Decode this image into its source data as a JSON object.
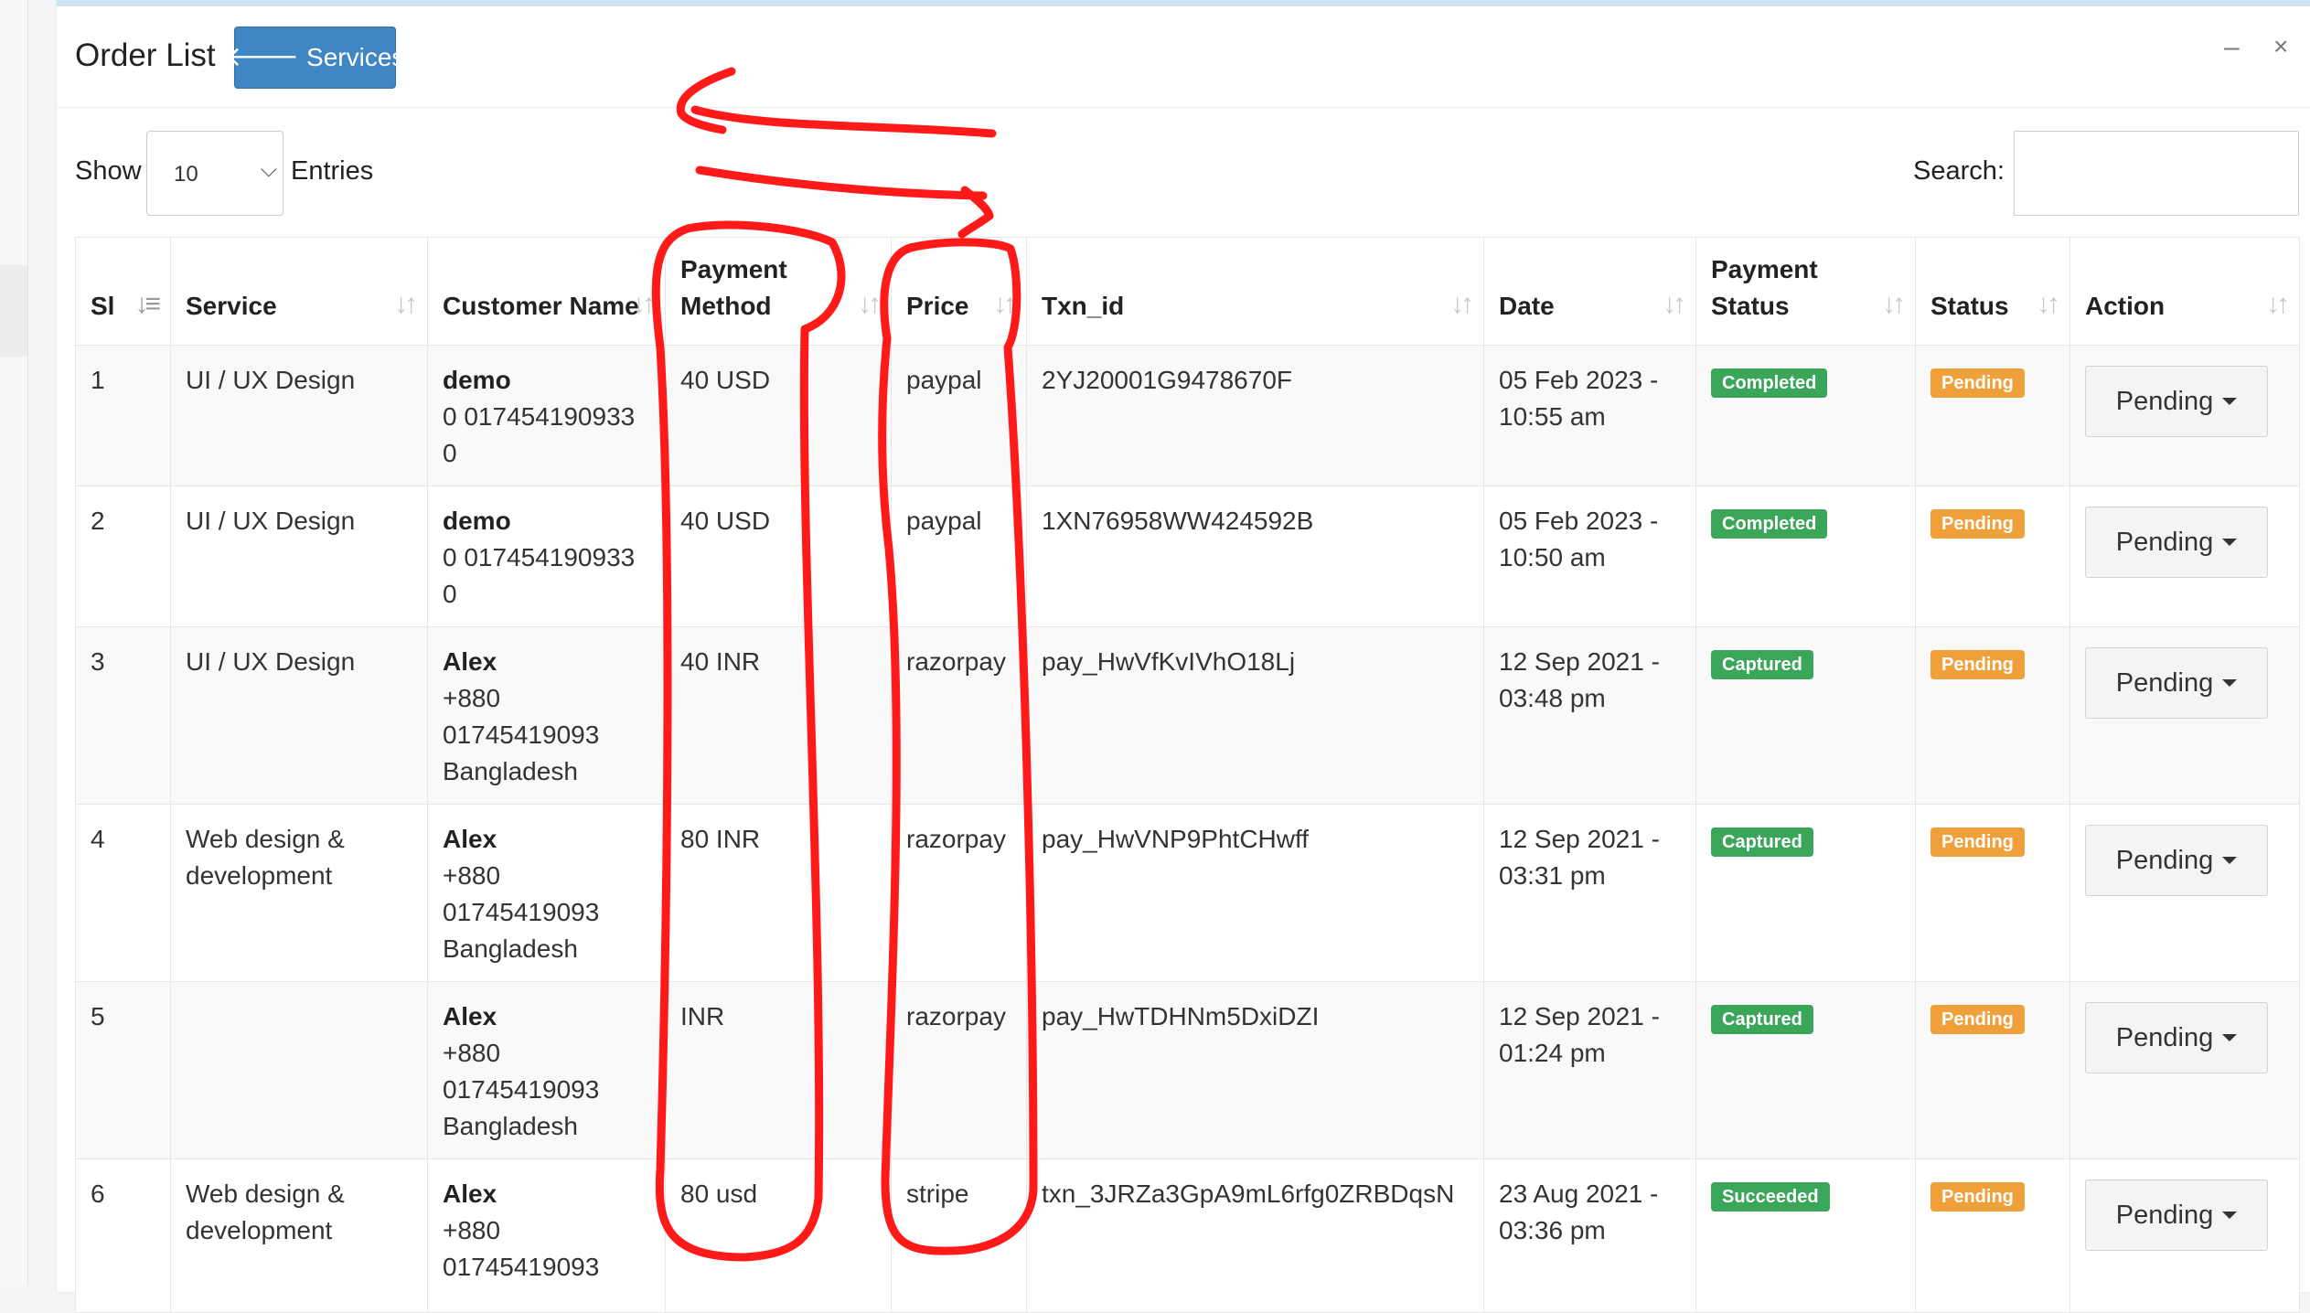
{
  "window": {
    "minimize_glyph": "–",
    "close_glyph": "×"
  },
  "header": {
    "title": "Order List",
    "services_button": {
      "icon": "arrow-left-icon",
      "label": "Services"
    }
  },
  "controls": {
    "show_label": "Show",
    "entries_value": "10",
    "entries_label": "Entries",
    "search_label": "Search:",
    "search_value": ""
  },
  "table": {
    "columns": [
      {
        "key": "sl",
        "label": "Sl"
      },
      {
        "key": "service",
        "label": "Service"
      },
      {
        "key": "customer",
        "label": "Customer Name"
      },
      {
        "key": "payment_method",
        "label": "Payment Method"
      },
      {
        "key": "price",
        "label": "Price"
      },
      {
        "key": "txn_id",
        "label": "Txn_id"
      },
      {
        "key": "date",
        "label": "Date"
      },
      {
        "key": "payment_status",
        "label": "Payment Status"
      },
      {
        "key": "status",
        "label": "Status"
      },
      {
        "key": "action",
        "label": "Action"
      }
    ],
    "rows": [
      {
        "sl": "1",
        "service": "UI / UX Design",
        "customer_name": "demo",
        "customer_phone": "0 017454190933",
        "customer_country": "0",
        "payment_method": "40 USD",
        "price": "paypal",
        "txn_id": "2YJ20001G9478670F",
        "date": "05 Feb 2023 -",
        "time": "10:55 am",
        "payment_status": "Completed",
        "status": "Pending",
        "action": "Pending"
      },
      {
        "sl": "2",
        "service": "UI / UX Design",
        "customer_name": "demo",
        "customer_phone": "0 017454190933",
        "customer_country": "0",
        "payment_method": "40 USD",
        "price": "paypal",
        "txn_id": "1XN76958WW424592B",
        "date": "05 Feb 2023 -",
        "time": "10:50 am",
        "payment_status": "Completed",
        "status": "Pending",
        "action": "Pending"
      },
      {
        "sl": "3",
        "service": "UI / UX Design",
        "customer_name": "Alex",
        "customer_phone": "+880 01745419093",
        "customer_country": "Bangladesh",
        "payment_method": "40 INR",
        "price": "razorpay",
        "txn_id": "pay_HwVfKvIVhO18Lj",
        "date": "12 Sep 2021 -",
        "time": "03:48 pm",
        "payment_status": "Captured",
        "status": "Pending",
        "action": "Pending"
      },
      {
        "sl": "4",
        "service": "Web design & development",
        "customer_name": "Alex",
        "customer_phone": "+880 01745419093",
        "customer_country": "Bangladesh",
        "payment_method": "80 INR",
        "price": "razorpay",
        "txn_id": "pay_HwVNP9PhtCHwff",
        "date": "12 Sep 2021 -",
        "time": "03:31 pm",
        "payment_status": "Captured",
        "status": "Pending",
        "action": "Pending"
      },
      {
        "sl": "5",
        "service": "",
        "customer_name": "Alex",
        "customer_phone": "+880 01745419093",
        "customer_country": "Bangladesh",
        "payment_method": "INR",
        "price": "razorpay",
        "txn_id": "pay_HwTDHNm5DxiDZI",
        "date": "12 Sep 2021 -",
        "time": "01:24 pm",
        "payment_status": "Captured",
        "status": "Pending",
        "action": "Pending"
      },
      {
        "sl": "6",
        "service": "Web design & development",
        "customer_name": "Alex",
        "customer_phone": "+880 01745419093",
        "customer_country": "",
        "payment_method": "80 usd",
        "price": "stripe",
        "txn_id": "txn_3JRZa3GpA9mL6rfg0ZRBDqsN",
        "date": "23 Aug 2021 -",
        "time": "03:36 pm",
        "payment_status": "Succeeded",
        "status": "Pending",
        "action": "Pending"
      }
    ]
  },
  "colors": {
    "primary_button": "#3f86c4",
    "badge_success": "#3aa65a",
    "badge_warning": "#f0a03a",
    "annotation": "#ff1a1a"
  }
}
